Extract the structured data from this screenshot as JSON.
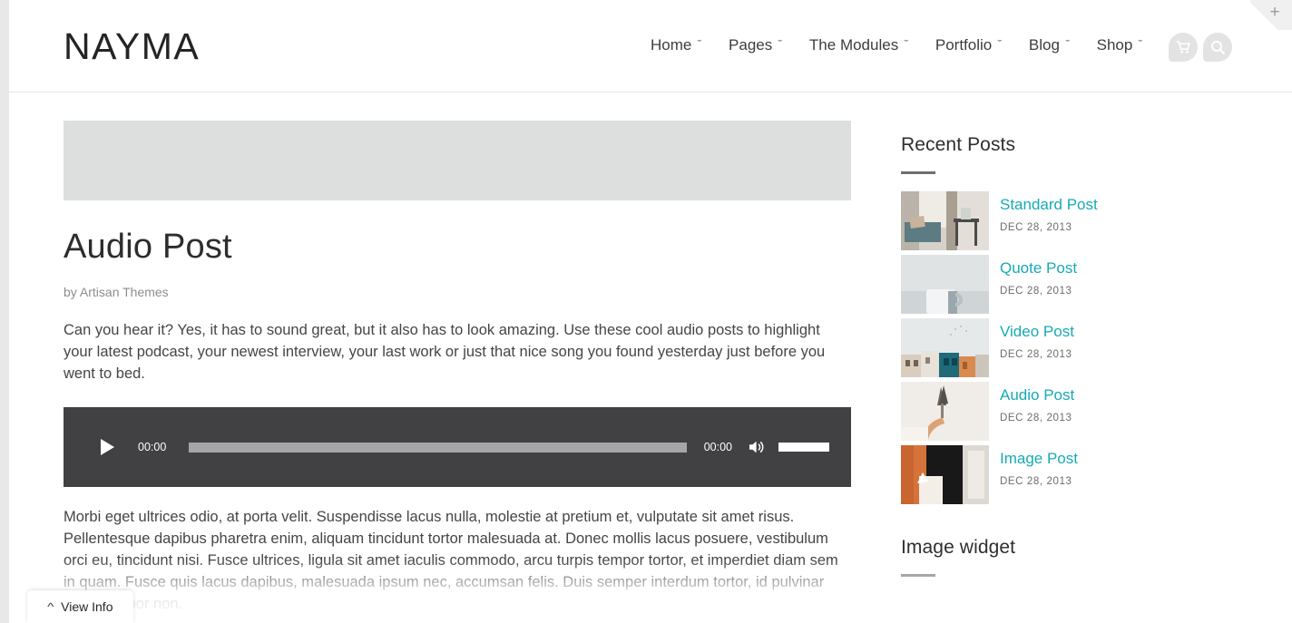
{
  "site": {
    "logo": "NAYMA"
  },
  "header": {
    "nav": [
      {
        "label": "Home",
        "caret": "chevron-down-icon"
      },
      {
        "label": "Pages",
        "caret": "chevron-down-icon"
      },
      {
        "label": "The Modules",
        "caret": "chevron-down-icon"
      },
      {
        "label": "Portfolio",
        "caret": "chevron-down-icon"
      },
      {
        "label": "Blog",
        "caret": "chevron-down-icon"
      },
      {
        "label": "Shop",
        "caret": "chevron-down-icon"
      }
    ],
    "caret_glyph": "ˇ",
    "icons": [
      {
        "name": "cart-icon"
      },
      {
        "name": "search-icon"
      }
    ],
    "corner_plus": "+"
  },
  "post": {
    "title": "Audio Post",
    "byline": "by Artisan Themes",
    "paragraph_1": "Can you hear it? Yes, it has to sound great, but it also has to look amazing. Use these cool audio posts to highlight your latest podcast, your newest interview, your last work or just that nice song you found yesterday just before you went to bed.",
    "paragraph_2": "Morbi eget ultrices odio, at porta velit. Suspendisse lacus nulla, molestie at pretium et, vulputate sit amet risus. Pellentesque dapibus pharetra enim, aliquam tincidunt tortor malesuada at. Donec mollis lacus posuere, vestibulum orci eu, tincidunt nisi. Fusce ultrices, ligula sit amet iaculis commodo, arcu turpis tempor tortor, et imperdiet diam sem in quam. Fusce quis lacus dapibus, malesuada ipsum nec, accumsan felis. Duis semper interdum tortor, id pulvinar tortor tempor non."
  },
  "audio_player": {
    "play_label": "play-icon",
    "current_time": "00:00",
    "duration": "00:00",
    "mute_label": "volume-icon",
    "progress_percent": 0,
    "volume_percent": 100
  },
  "sidebar": {
    "recent_posts": {
      "title": "Recent Posts",
      "items": [
        {
          "title": "Standard Post",
          "date": "DEC 28, 2013",
          "thumb": "living-room-photo"
        },
        {
          "title": "Quote Post",
          "date": "DEC 28, 2013",
          "thumb": "mug-photo"
        },
        {
          "title": "Video Post",
          "date": "DEC 28, 2013",
          "thumb": "townhouses-photo"
        },
        {
          "title": "Audio Post",
          "date": "DEC 28, 2013",
          "thumb": "dried-flowers-photo"
        },
        {
          "title": "Image Post",
          "date": "DEC 28, 2013",
          "thumb": "doorway-photo"
        }
      ]
    },
    "image_widget": {
      "title": "Image widget"
    }
  },
  "footer_bar": {
    "label": "View Info",
    "chevron": "chevron-up-icon"
  },
  "colors": {
    "link_teal": "#16abb3",
    "player_bg": "#414144",
    "placeholder_gray": "#dddede",
    "page_bg": "#e8e8e8"
  }
}
